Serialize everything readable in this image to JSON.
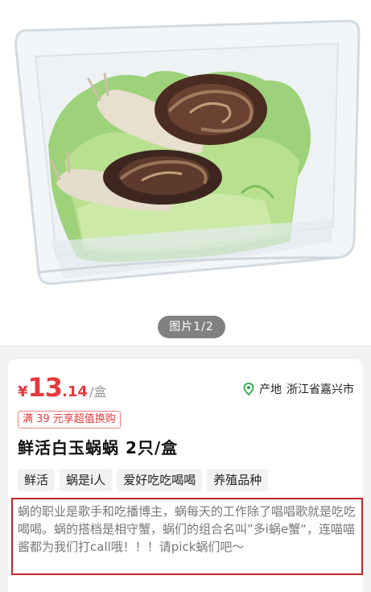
{
  "gallery": {
    "page_indicator": "图片1/2",
    "image_subject": "two snails on lettuce in a clear plastic box"
  },
  "price": {
    "currency": "¥",
    "integer": "13",
    "decimal": ".14",
    "unit": "/盒"
  },
  "origin": {
    "icon": "location-pin-icon",
    "label": "产地",
    "value": "浙江省嘉兴市"
  },
  "promo": "满 39 元享超值换购",
  "product_title": "鲜活白玉蜗蜗 2只/盒",
  "tags": [
    "鲜活",
    "蜗是i人",
    "爱好吃吃喝喝",
    "养殖品种"
  ],
  "description": "蜗的职业是歌手和吃播博主，蜗每天的工作除了唱唱歌就是吃吃喝喝。蜗的搭档是相守蟹，蜗们的组合名叫”多i蜗e蟹“，连喵喵酱都为我们打call哦！！！请pick蜗们吧～",
  "colors": {
    "accent_red": "#e4393c",
    "origin_green": "#2aa84a",
    "highlight_border": "#c0262d"
  }
}
